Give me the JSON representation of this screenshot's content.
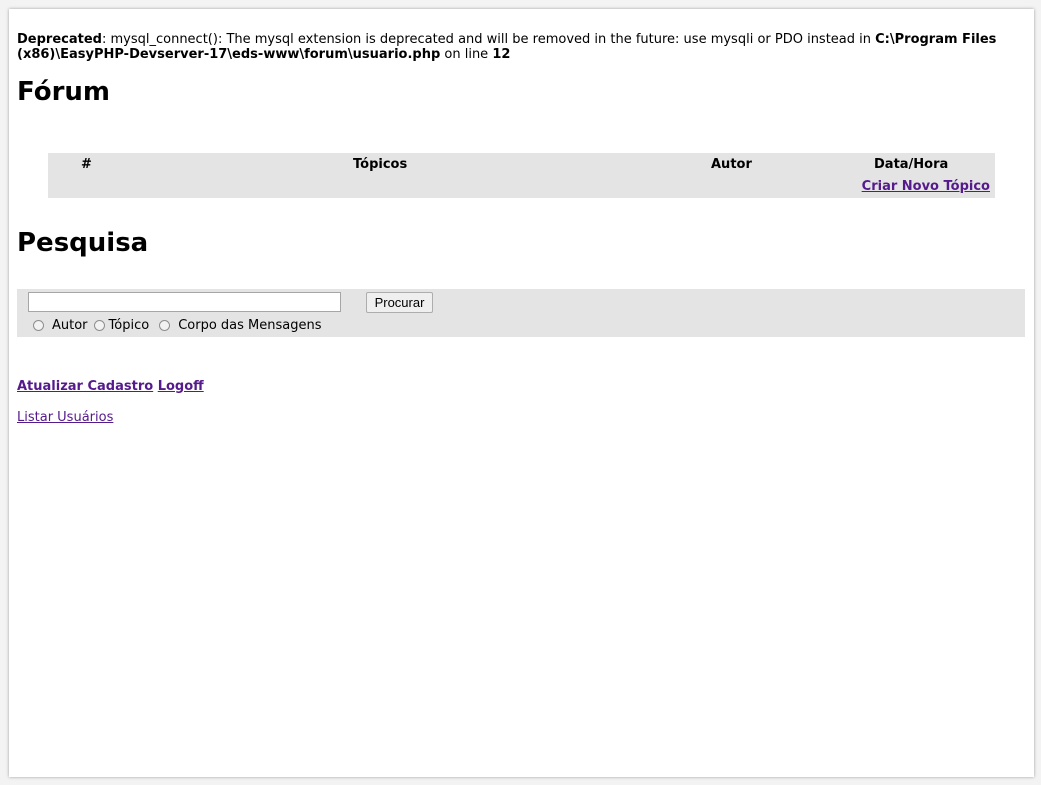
{
  "warning": {
    "label": "Deprecated",
    "message": ": mysql_connect(): The mysql extension is deprecated and will be removed in the future: use mysqli or PDO instead in ",
    "path": "C:\\Program Files (x86)\\EasyPHP-Devserver-17\\eds-www\\forum\\usuario.php",
    "line_text": " on line ",
    "line_number": "12"
  },
  "forum": {
    "title": "Fórum",
    "columns": [
      "#",
      "Tópicos",
      "Autor",
      "Data/Hora"
    ],
    "new_topic_link": "Criar Novo Tópico"
  },
  "search": {
    "title": "Pesquisa",
    "input_value": "",
    "button_label": "Procurar",
    "options": [
      "Autor",
      "Tópico",
      "Corpo das Mensagens"
    ]
  },
  "links": {
    "update_profile": "Atualizar Cadastro",
    "logoff": "Logoff",
    "list_users": "Listar Usuários"
  },
  "colors": {
    "link": "#551a8b",
    "panel_bg": "#e4e4e4"
  }
}
